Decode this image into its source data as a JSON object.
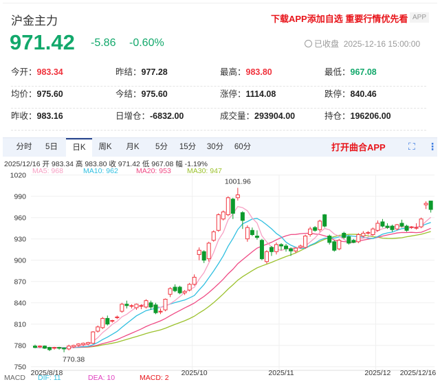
{
  "header": {
    "title": "沪金主力",
    "promo": "下载APP添加自选 重要行情优先看",
    "app_badge": "APP",
    "price": "971.42",
    "change": "-5.86",
    "change_pct": "-0.60%",
    "status": "已收盘",
    "datetime": "2025-12-16 15:00:00"
  },
  "stats": [
    [
      {
        "k": "今开：",
        "v": "983.34",
        "c": "red"
      },
      {
        "k": "昨结：",
        "v": "977.28",
        "c": ""
      },
      {
        "k": "最高：",
        "v": "983.80",
        "c": "red"
      },
      {
        "k": "最低：",
        "v": "967.08",
        "c": "green"
      }
    ],
    [
      {
        "k": "均价：",
        "v": "975.60",
        "c": ""
      },
      {
        "k": "今结：",
        "v": "975.60",
        "c": ""
      },
      {
        "k": "涨停：",
        "v": "1114.08",
        "c": ""
      },
      {
        "k": "跌停：",
        "v": "840.46",
        "c": ""
      }
    ],
    [
      {
        "k": "昨收：",
        "v": "983.16",
        "c": ""
      },
      {
        "k": "日增仓：",
        "v": "-6832.00",
        "c": ""
      },
      {
        "k": "成交量：",
        "v": "293904.00",
        "c": ""
      },
      {
        "k": "持仓：",
        "v": "196206.00",
        "c": ""
      }
    ]
  ],
  "tabs": [
    "分时",
    "5日",
    "日K",
    "周K",
    "月K",
    "5分",
    "15分",
    "30分",
    "60分"
  ],
  "active_tab": "日K",
  "open_app": "打开曲合APP",
  "info_line": "2025/12/16  开 983.34  高 983.80  收 971.42  低 967.08  幅 -1.19%",
  "ma_legend": [
    {
      "label": "MA5: 968",
      "color": "#f7a1c4"
    },
    {
      "label": "MA10: 962",
      "color": "#2fbfe0"
    },
    {
      "label": "MA20: 953",
      "color": "#ef4a84"
    },
    {
      "label": "MA30: 947",
      "color": "#9bc12c"
    }
  ],
  "macd_legend": [
    {
      "label": "MACD",
      "color": "#666"
    },
    {
      "label": "DIF: 11",
      "color": "#2fbfe0"
    },
    {
      "label": "DEA: 10",
      "color": "#e040c0"
    },
    {
      "label": "MACD: 2",
      "color": "#e8141a"
    }
  ],
  "chart_data": {
    "type": "candlestick",
    "y_ticks": [
      1020,
      990,
      960,
      930,
      900,
      870,
      840,
      810,
      780,
      750
    ],
    "ylim": [
      750,
      1020
    ],
    "x_labels": [
      {
        "label": "2025/8/18",
        "index": 0
      },
      {
        "label": "2025/10",
        "index": 33
      },
      {
        "label": "2025/11",
        "index": 51
      },
      {
        "label": "2025/12",
        "index": 71
      },
      {
        "label": "2025/12/16",
        "index": 82
      }
    ],
    "max_label": "1001.96",
    "max_index": 42,
    "min_label": "770.38",
    "min_index": 6,
    "colors": {
      "up": "#f0323c",
      "down": "#0d9a2c"
    },
    "ohlc": [
      [
        779,
        781,
        776,
        777
      ],
      [
        778,
        780,
        776,
        779
      ],
      [
        779,
        780,
        775,
        776
      ],
      [
        777,
        778,
        772,
        774
      ],
      [
        776,
        778,
        774,
        777
      ],
      [
        777,
        778,
        774,
        776
      ],
      [
        776,
        777,
        770.38,
        775
      ],
      [
        775,
        781,
        773,
        779
      ],
      [
        778,
        781,
        776,
        780
      ],
      [
        780,
        783,
        778,
        782
      ],
      [
        781,
        784,
        779,
        783
      ],
      [
        782,
        785,
        780,
        784
      ],
      [
        783,
        800,
        782,
        799
      ],
      [
        800,
        808,
        798,
        806
      ],
      [
        805,
        820,
        803,
        818
      ],
      [
        818,
        822,
        808,
        810
      ],
      [
        814,
        816,
        812,
        815
      ],
      [
        819,
        822,
        817,
        820
      ],
      [
        828,
        840,
        826,
        838
      ],
      [
        838,
        843,
        832,
        836
      ],
      [
        836,
        838,
        832,
        836
      ],
      [
        833,
        839,
        830,
        838
      ],
      [
        836,
        838,
        831,
        836
      ],
      [
        834,
        845,
        832,
        843
      ],
      [
        840,
        843,
        830,
        834
      ],
      [
        837,
        840,
        824,
        826
      ],
      [
        828,
        832,
        824,
        828
      ],
      [
        830,
        846,
        828,
        845
      ],
      [
        852,
        862,
        848,
        860
      ],
      [
        862,
        866,
        855,
        857
      ],
      [
        862,
        864,
        852,
        854
      ],
      [
        854,
        858,
        851,
        856
      ],
      [
        858,
        868,
        856,
        866
      ],
      [
        866,
        880,
        864,
        876
      ],
      [
        908,
        918,
        900,
        914
      ],
      [
        912,
        914,
        896,
        900
      ],
      [
        902,
        926,
        898,
        924
      ],
      [
        928,
        942,
        926,
        940
      ],
      [
        942,
        966,
        940,
        964
      ],
      [
        958,
        970,
        956,
        968
      ],
      [
        964,
        990,
        962,
        988
      ],
      [
        986,
        988,
        958,
        966
      ],
      [
        988,
        1001.96,
        984,
        992
      ],
      [
        967,
        969,
        944,
        956
      ],
      [
        930,
        949,
        926,
        946
      ],
      [
        942,
        946,
        934,
        936
      ],
      [
        934,
        942,
        929,
        932
      ],
      [
        928,
        930,
        900,
        902
      ],
      [
        898,
        914,
        895,
        912
      ],
      [
        918,
        920,
        906,
        912
      ],
      [
        912,
        925,
        908,
        922
      ],
      [
        922,
        924,
        914,
        920
      ],
      [
        920,
        923,
        912,
        916
      ],
      [
        916,
        918,
        906,
        913
      ],
      [
        913,
        918,
        910,
        917
      ],
      [
        918,
        922,
        916,
        920
      ],
      [
        918,
        936,
        916,
        934
      ],
      [
        936,
        947,
        933,
        944
      ],
      [
        946,
        948,
        940,
        942
      ],
      [
        943,
        957,
        940,
        955
      ],
      [
        964,
        965,
        946,
        948
      ],
      [
        934,
        936,
        922,
        925
      ],
      [
        926,
        928,
        912,
        914
      ],
      [
        916,
        930,
        914,
        928
      ],
      [
        938,
        940,
        930,
        932
      ],
      [
        933,
        935,
        922,
        924
      ],
      [
        928,
        930,
        924,
        925
      ],
      [
        926,
        938,
        924,
        936
      ],
      [
        934,
        941,
        932,
        938
      ],
      [
        938,
        941,
        936,
        939
      ],
      [
        936,
        946,
        934,
        944
      ],
      [
        942,
        956,
        940,
        952
      ],
      [
        954,
        958,
        946,
        948
      ],
      [
        948,
        952,
        944,
        946
      ],
      [
        948,
        950,
        940,
        943
      ],
      [
        944,
        951,
        942,
        950
      ],
      [
        952,
        957,
        946,
        948
      ],
      [
        948,
        950,
        940,
        942
      ],
      [
        946,
        948,
        944,
        947
      ],
      [
        945,
        952,
        943,
        946
      ],
      [
        947,
        960,
        945,
        958
      ],
      [
        978,
        983,
        972,
        980
      ],
      [
        983.34,
        983.8,
        967.08,
        971.42
      ]
    ]
  }
}
